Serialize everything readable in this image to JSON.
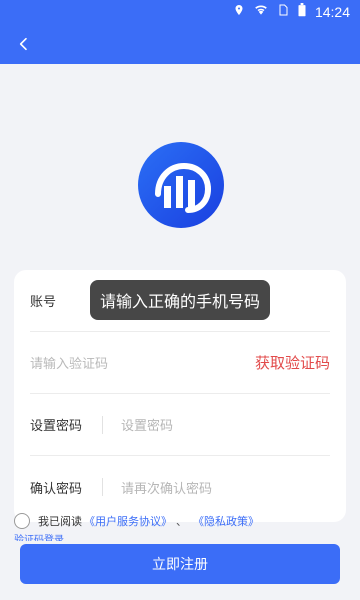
{
  "status_bar": {
    "time": "14:24"
  },
  "form": {
    "account_label": "账号",
    "code_placeholder": "请输入验证码",
    "get_code_label": "获取验证码",
    "set_password_label": "设置密码",
    "set_password_placeholder": "设置密码",
    "confirm_password_label": "确认密码",
    "confirm_password_placeholder": "请再次确认密码"
  },
  "toast": {
    "message": "请输入正确的手机号码"
  },
  "agreement": {
    "prefix": "我已阅读",
    "user_agreement": "《用户服务协议》",
    "separator": "、",
    "privacy_policy": "《隐私政策》"
  },
  "secondary_link": "验证码登录",
  "register_label": "立即注册",
  "colors": {
    "primary": "#3b6df7",
    "danger": "#e24b4b"
  },
  "icons": [
    "location-icon",
    "wifi-icon",
    "sim-icon",
    "battery-icon",
    "back-icon"
  ]
}
